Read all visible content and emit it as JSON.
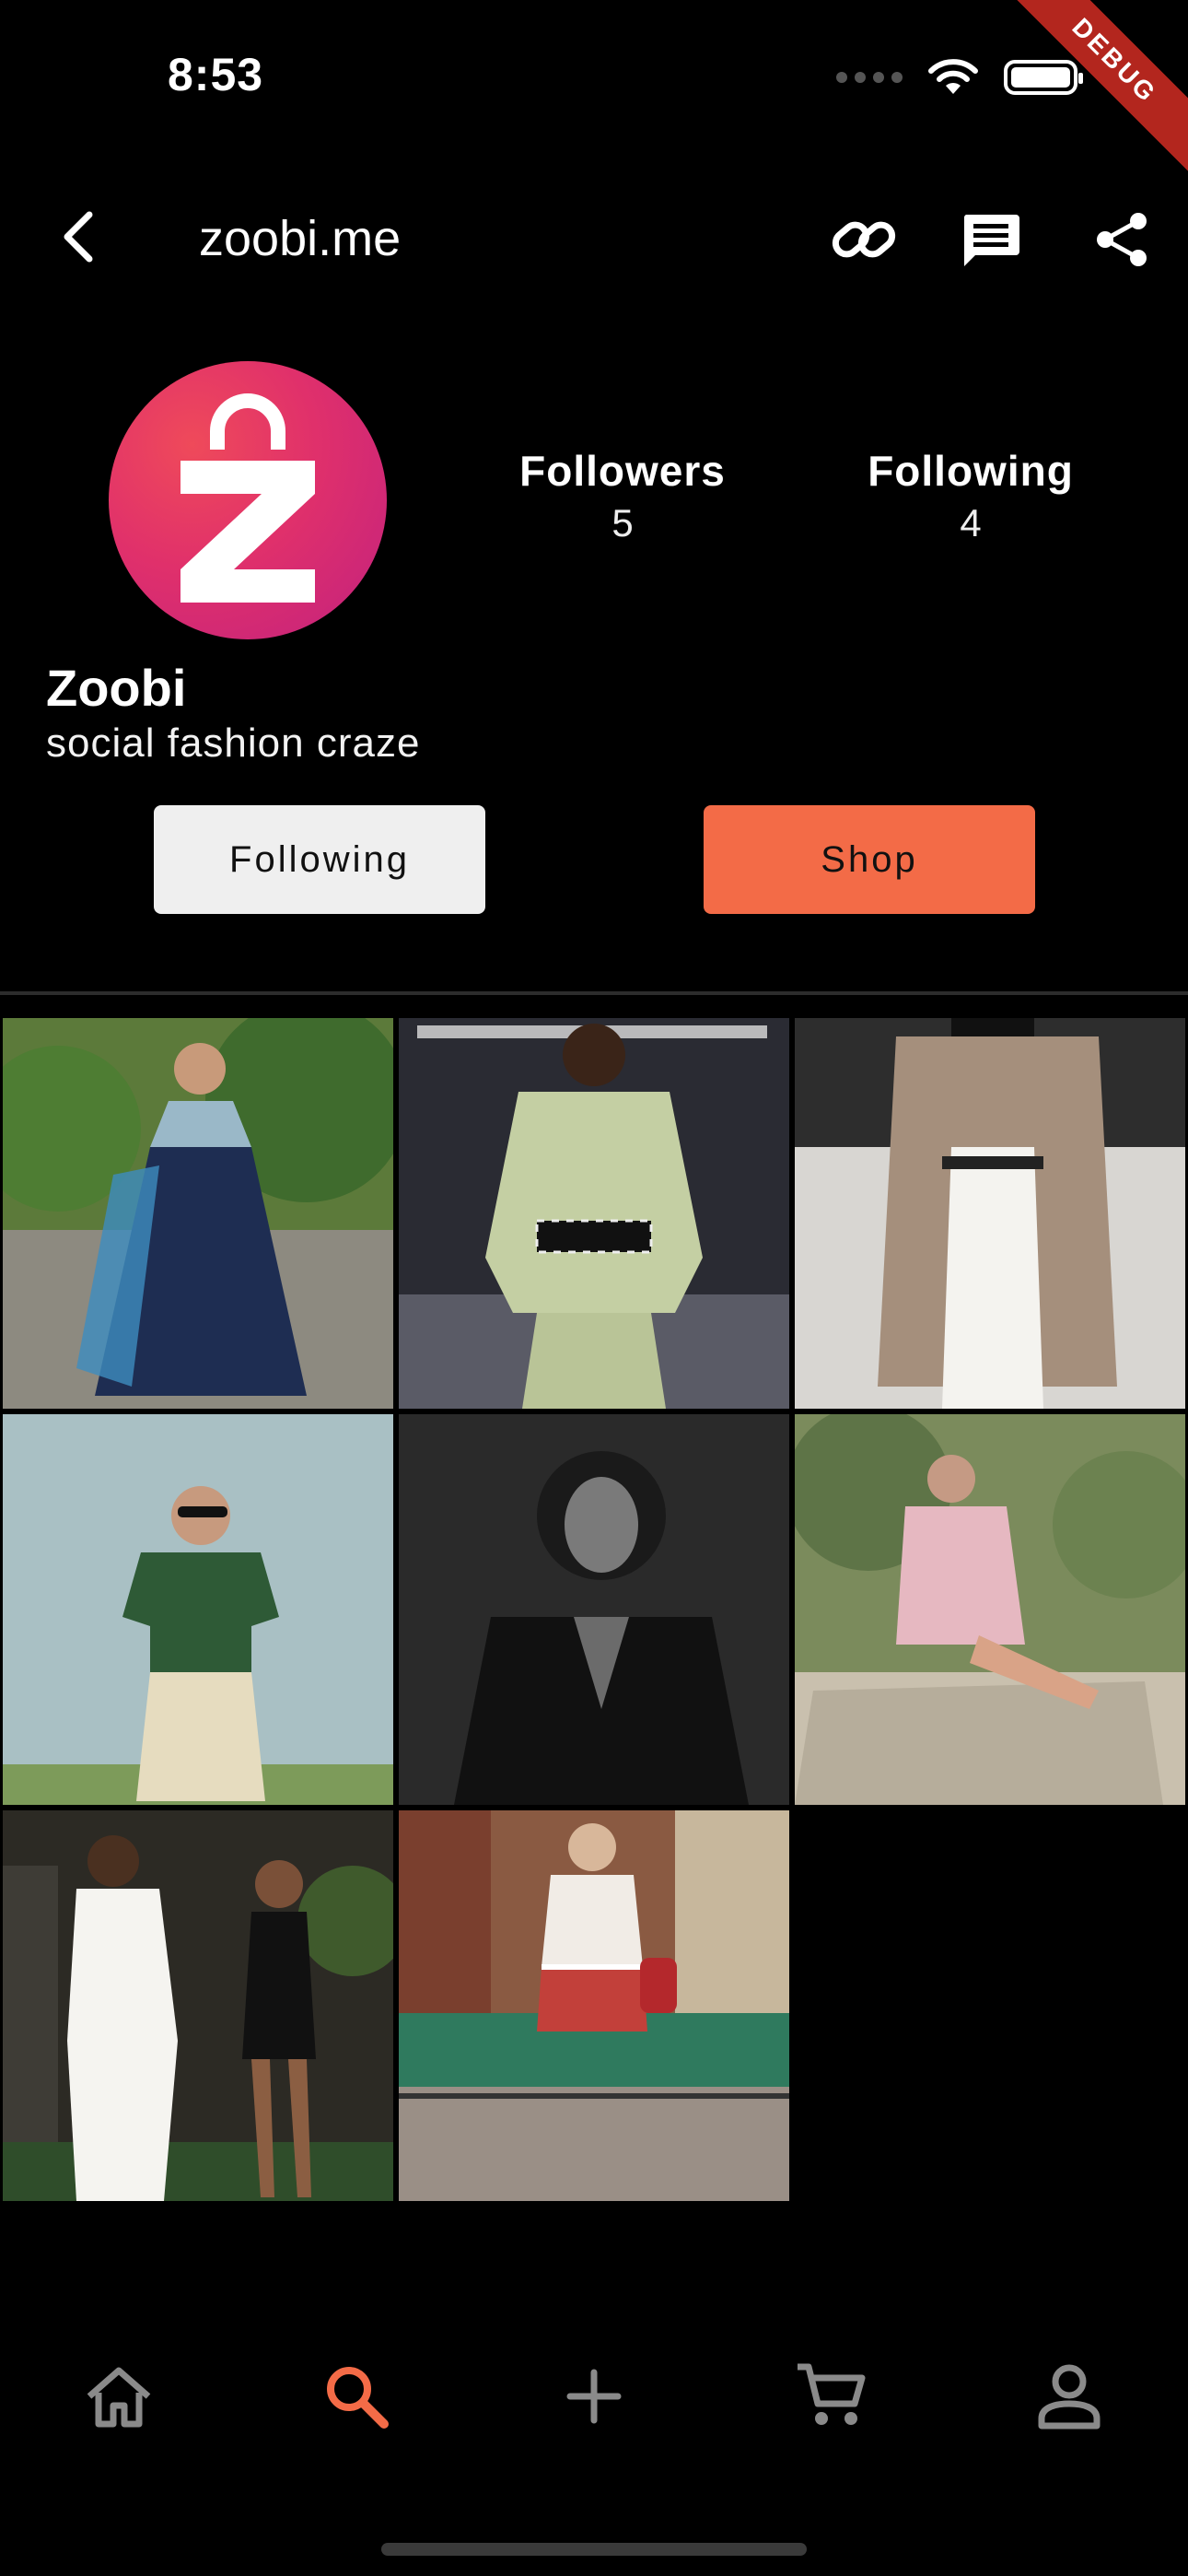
{
  "status_bar": {
    "time": "8:53",
    "debug_label": "DEBUG"
  },
  "app_bar": {
    "title": "zoobi.me",
    "icons": [
      "link-icon",
      "message-icon",
      "share-icon"
    ]
  },
  "profile": {
    "name": "Zoobi",
    "bio": "social fashion craze",
    "stats": [
      {
        "label": "Followers",
        "value": "5"
      },
      {
        "label": "Following",
        "value": "4"
      }
    ],
    "actions": {
      "following_label": "Following",
      "shop_label": "Shop"
    }
  },
  "colors": {
    "accent": "#f36b47",
    "background": "#000000",
    "button_light": "#efefef",
    "avatar_pink": "#e0306b"
  },
  "posts": [
    {
      "subject": "blue embroidered lehenga outfit"
    },
    {
      "subject": "sage green structured suit runway"
    },
    {
      "subject": "camel coat white trousers runway"
    },
    {
      "subject": "green tee beige trousers"
    },
    {
      "subject": "black leather blazer portrait"
    },
    {
      "subject": "floral dress desert rocks"
    },
    {
      "subject": "white suit couple evening"
    },
    {
      "subject": "striped shorts venice canal"
    }
  ],
  "bottom_nav": {
    "items": [
      "home-icon",
      "search-icon",
      "add-icon",
      "cart-icon",
      "profile-icon"
    ],
    "active": "search-icon"
  }
}
